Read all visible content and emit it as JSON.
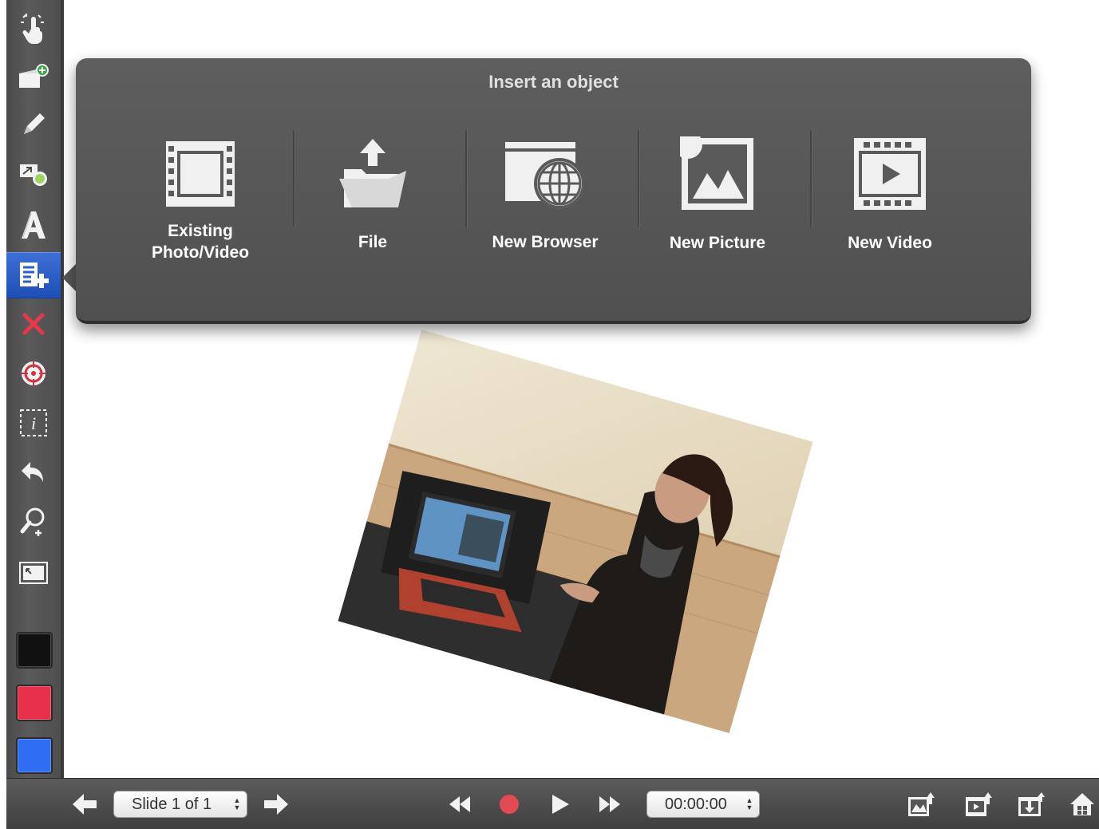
{
  "popover": {
    "title": "Insert an object",
    "options": [
      {
        "label_line1": "Existing",
        "label_line2": "Photo/Video",
        "icon": "film-strip-icon"
      },
      {
        "label": "File",
        "icon": "upload-folder-icon"
      },
      {
        "label": "New Browser",
        "icon": "globe-browser-icon"
      },
      {
        "label": "New Picture",
        "icon": "picture-icon"
      },
      {
        "label": "New Video",
        "icon": "video-play-icon"
      }
    ]
  },
  "toolbar": {
    "tools": [
      "hand-pointer-icon",
      "add-slide-icon",
      "pencil-icon",
      "shapes-icon",
      "text-icon",
      "insert-object-icon",
      "delete-icon",
      "target-icon",
      "info-box-icon",
      "undo-icon",
      "zoom-icon",
      "fit-screen-icon"
    ],
    "active_tool": "insert-object-icon",
    "colors": {
      "black": "#111111",
      "red": "#e8304a",
      "blue": "#2f6ef2"
    }
  },
  "bottombar": {
    "slide_label": "Slide 1 of 1",
    "time": "00:00:00"
  }
}
